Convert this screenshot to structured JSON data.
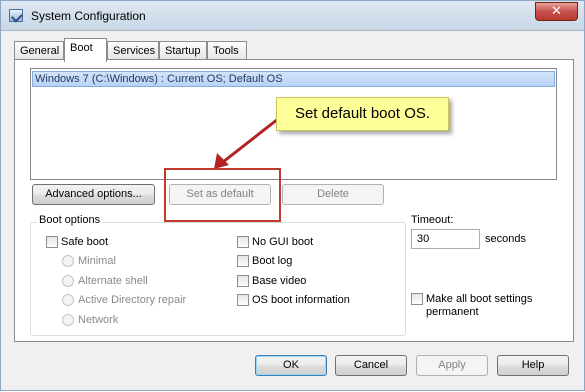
{
  "window": {
    "title": "System Configuration",
    "close_glyph": "✕"
  },
  "tabs": [
    {
      "label": "General"
    },
    {
      "label": "Boot"
    },
    {
      "label": "Services"
    },
    {
      "label": "Startup"
    },
    {
      "label": "Tools"
    }
  ],
  "active_tab": "Boot",
  "os_list": {
    "selected_entry": "Windows 7 (C:\\Windows) : Current OS; Default OS"
  },
  "buttons": {
    "advanced": "Advanced options...",
    "set_default": "Set as default",
    "delete": "Delete",
    "ok": "OK",
    "cancel": "Cancel",
    "apply": "Apply",
    "help": "Help"
  },
  "callout": {
    "text": "Set default boot OS.",
    "color": "#ffff99",
    "arrow_color": "#b22222"
  },
  "boot_options": {
    "label": "Boot options",
    "safe_boot": {
      "label": "Safe boot",
      "checked": false
    },
    "radios": [
      {
        "label": "Minimal"
      },
      {
        "label": "Alternate shell"
      },
      {
        "label": "Active Directory repair"
      },
      {
        "label": "Network"
      }
    ],
    "right_checks": [
      {
        "label": "No GUI boot",
        "checked": false
      },
      {
        "label": "Boot log",
        "checked": false
      },
      {
        "label": "Base video",
        "checked": false
      },
      {
        "label": "OS boot information",
        "checked": false
      }
    ]
  },
  "timeout": {
    "label": "Timeout:",
    "value": "30",
    "unit": "seconds"
  },
  "permanent": {
    "label": "Make all boot settings permanent",
    "checked": false
  }
}
